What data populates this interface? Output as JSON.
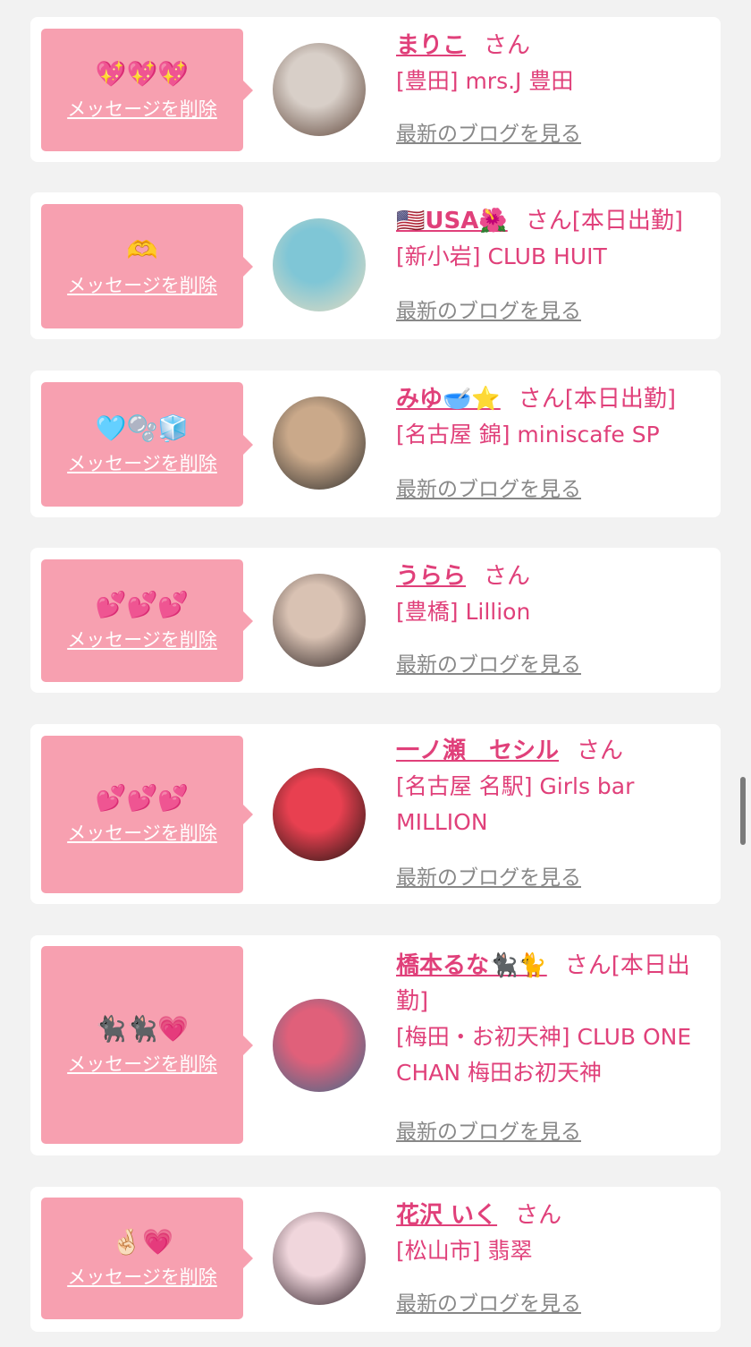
{
  "messages": [
    {
      "emoji": "💖💖💖",
      "delete_label": "メッセージを削除",
      "name": "まりこ",
      "suffix": "さん",
      "shop": "[豊田] mrs.J 豊田",
      "blog_label": "最新のブログを見る",
      "avatar_colors": [
        "#d8cfc8",
        "#5a4034"
      ]
    },
    {
      "emoji": "🫶",
      "delete_label": "メッセージを削除",
      "name": "🇺🇸USA🌺",
      "suffix": "さん[本日出勤]",
      "shop": "[新小岩] CLUB HUIT",
      "blog_label": "最新のブログを見る",
      "avatar_colors": [
        "#7fc6d6",
        "#e8dcc0"
      ]
    },
    {
      "emoji": "🩵🫧🧊",
      "delete_label": "メッセージを削除",
      "name": "みゆ🥣⭐",
      "suffix": "さん[本日出勤]",
      "shop": "[名古屋 錦] miniscafe SP",
      "blog_label": "最新のブログを見る",
      "avatar_colors": [
        "#caa98a",
        "#2b2b2b"
      ]
    },
    {
      "emoji": "💕💕💕",
      "delete_label": "メッセージを削除",
      "name": "うらら",
      "suffix": "さん",
      "shop": "[豊橋] Lillion",
      "blog_label": "最新のブログを見る",
      "avatar_colors": [
        "#d9c2b3",
        "#2a2020"
      ]
    },
    {
      "emoji": "💕💕💕",
      "delete_label": "メッセージを削除",
      "name": "一ノ瀬　セシル",
      "suffix": "さん",
      "shop": "[名古屋 名駅] Girls bar MILLION",
      "blog_label": "最新のブログを見る",
      "avatar_colors": [
        "#e84050",
        "#1a1410"
      ]
    },
    {
      "emoji": "🐈‍⬛🐈‍⬛💗",
      "delete_label": "メッセージを削除",
      "name": "橋本るな🐈‍⬛🐈",
      "suffix": "さん[本日出勤]",
      "shop": "[梅田・お初天神] CLUB ONE CHAN 梅田お初天神",
      "blog_label": "最新のブログを見る",
      "avatar_colors": [
        "#e0607a",
        "#3a6a8a"
      ]
    },
    {
      "emoji": "🤞🏻💗",
      "delete_label": "メッセージを削除",
      "name": "花沢 いく",
      "suffix": "さん",
      "shop": "[松山市] 翡翠",
      "blog_label": "最新のブログを見る",
      "avatar_colors": [
        "#f0d6dc",
        "#2a1a22"
      ]
    }
  ]
}
